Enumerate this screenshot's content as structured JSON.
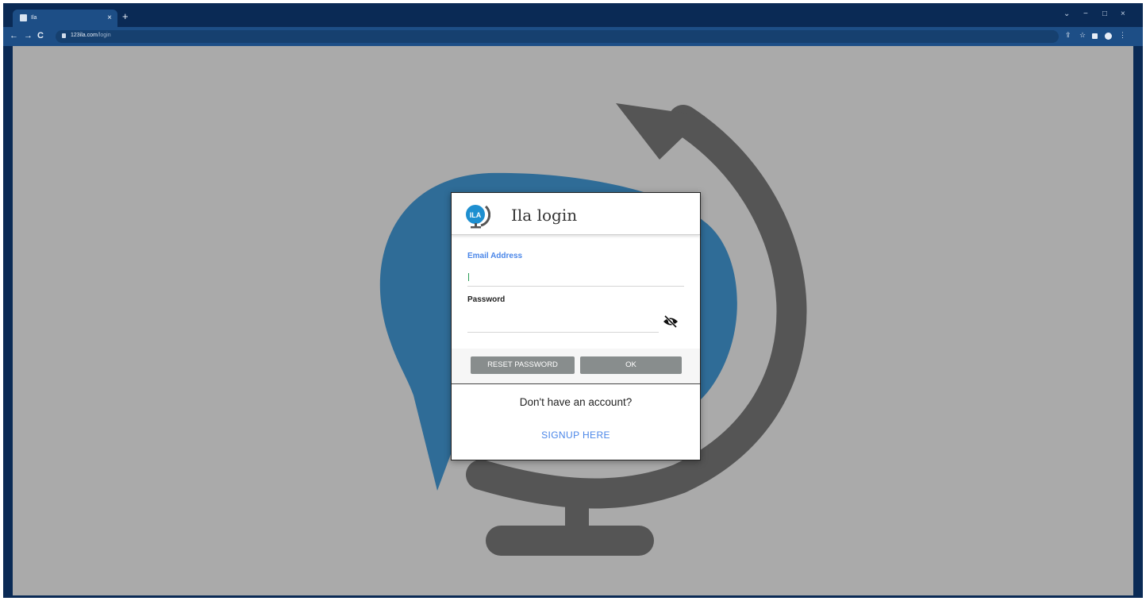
{
  "browser": {
    "tab_title": "Ila",
    "tab_close": "×",
    "new_tab": "+",
    "url_host": "123ila.com",
    "url_path": "/login",
    "nav": {
      "back": "←",
      "forward": "→",
      "reload": "C"
    },
    "window_controls": {
      "chevron": "⌄",
      "minimize": "−",
      "maximize": "□",
      "close": "×"
    },
    "toolbar": {
      "share": "⇪",
      "star": "☆",
      "menu": "⋮"
    }
  },
  "dialog": {
    "logo_text": "ILA",
    "title": "Ila login",
    "email_label": "Email Address",
    "email_value": "",
    "password_label": "Password",
    "password_value": "",
    "reset_button": "RESET PASSWORD",
    "ok_button": "OK",
    "signup_question": "Don't have an account?",
    "signup_link": "SIGNUP HERE"
  },
  "colors": {
    "page_background": "#aaaaaa",
    "globe_blue": "#2f6c97",
    "globe_arc": "#555555",
    "accent_link": "#4a86e8",
    "button_gray": "#888d8d",
    "browser_frame": "#0a2a55"
  }
}
